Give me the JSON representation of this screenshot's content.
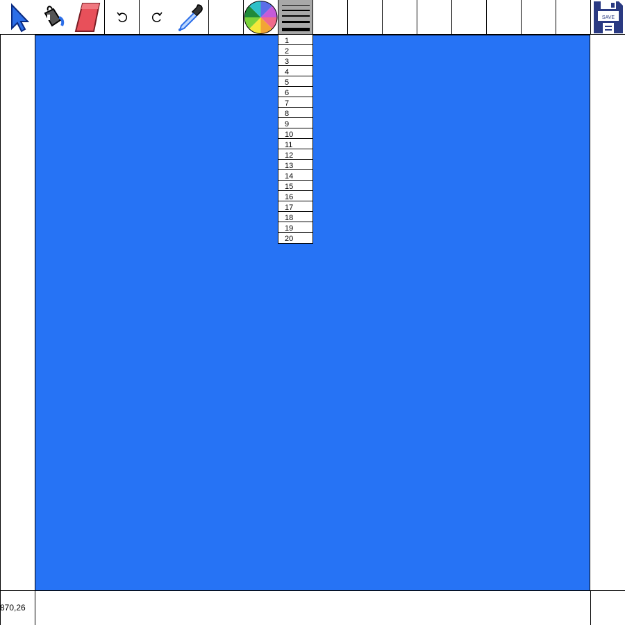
{
  "toolbar": {
    "tools": [
      {
        "name": "pointer-tool",
        "icon": "arrow-cursor-icon"
      },
      {
        "name": "fill-bucket-tool",
        "icon": "paint-bucket-icon"
      },
      {
        "name": "eraser-tool",
        "icon": "eraser-icon"
      },
      {
        "name": "undo-button",
        "icon": "undo-icon"
      },
      {
        "name": "redo-button",
        "icon": "redo-icon"
      },
      {
        "name": "eyedropper-tool",
        "icon": "eyedropper-icon"
      },
      {
        "name": "color-picker",
        "icon": "color-wheel-icon"
      },
      {
        "name": "line-width-selector",
        "icon": "line-width-icon"
      },
      {
        "name": "save-button",
        "icon": "floppy-disk-icon",
        "label": "SAVE"
      }
    ]
  },
  "canvas": {
    "fill_color": "#2673f5"
  },
  "line_width_menu": {
    "options": [
      "1",
      "2",
      "3",
      "4",
      "5",
      "6",
      "7",
      "8",
      "9",
      "10",
      "11",
      "12",
      "13",
      "14",
      "15",
      "16",
      "17",
      "18",
      "19",
      "20"
    ]
  },
  "status": {
    "cursor_coords": "870,26"
  },
  "colors": {
    "canvas_blue": "#2673f5",
    "selected_tool_bg": "#a8a8a8",
    "save_icon_navy": "#2a3a82"
  }
}
